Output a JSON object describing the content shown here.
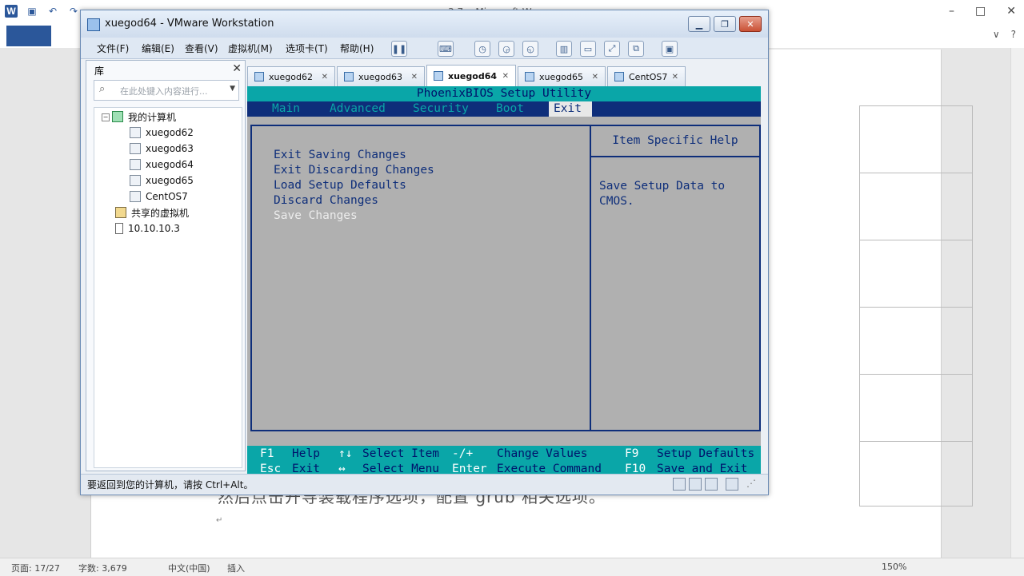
{
  "word": {
    "title": "3.7... Microsoft W...",
    "doc_line": "然后点击开导装载程序选项，配置 grub 相关选项。",
    "status": {
      "page": "页面: 17/27",
      "words": "字数: 3,679",
      "lang": "中文(中国)",
      "mode": "插入",
      "zoom": "150%"
    }
  },
  "vmware": {
    "title": "xuegod64 - VMware Workstation",
    "menu": [
      "文件(F)",
      "编辑(E)",
      "查看(V)",
      "虚拟机(M)",
      "选项卡(T)",
      "帮助(H)"
    ],
    "library": {
      "title": "库",
      "search_placeholder": "在此处键入内容进行...",
      "tree": {
        "root": "我的计算机",
        "vms": [
          "xuegod62",
          "xuegod63",
          "xuegod64",
          "xuegod65",
          "CentOS7"
        ],
        "shared": "共享的虚拟机",
        "remote": "10.10.10.3"
      }
    },
    "tabs": [
      {
        "label": "xuegod62",
        "active": false
      },
      {
        "label": "xuegod63",
        "active": false
      },
      {
        "label": "xuegod64",
        "active": true
      },
      {
        "label": "xuegod65",
        "active": false
      },
      {
        "label": "CentOS7",
        "active": false
      }
    ],
    "status_message": "要返回到您的计算机，请按 Ctrl+Alt。"
  },
  "bios": {
    "title": "PhoenixBIOS Setup Utility",
    "menus": [
      "Main",
      "Advanced",
      "Security",
      "Boot",
      "Exit"
    ],
    "active_menu": "Exit",
    "options": [
      "Exit Saving Changes",
      "Exit Discarding Changes",
      "Load Setup Defaults",
      "Discard Changes",
      "Save Changes"
    ],
    "selected_option": "Save Changes",
    "help_title": "Item Specific Help",
    "help_text": "Save Setup Data to\nCMOS.",
    "footer": [
      {
        "key": "F1",
        "desc": "Help"
      },
      {
        "key": "↑↓",
        "desc": "Select Item"
      },
      {
        "key": "-/+",
        "desc": "Change Values"
      },
      {
        "key": "F9",
        "desc": "Setup Defaults"
      },
      {
        "key": "Esc",
        "desc": "Exit"
      },
      {
        "key": "↔",
        "desc": "Select Menu"
      },
      {
        "key": "Enter",
        "desc": "Execute Command"
      },
      {
        "key": "F10",
        "desc": "Save and Exit"
      }
    ]
  }
}
